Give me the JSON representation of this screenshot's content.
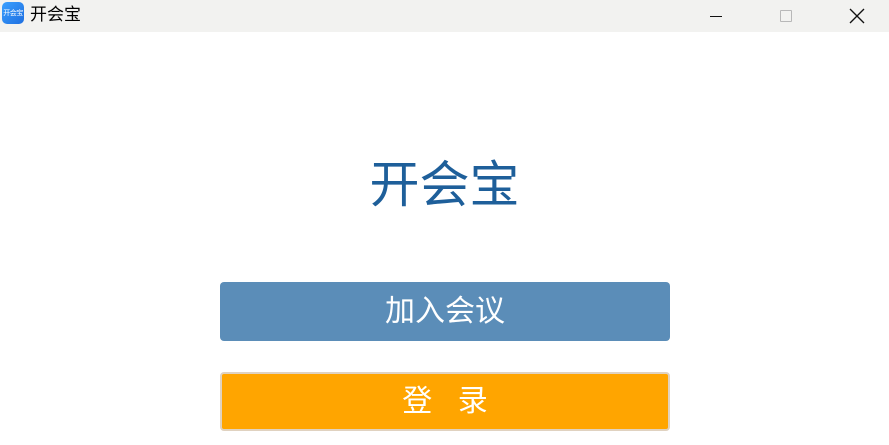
{
  "window": {
    "title": "开会宝",
    "icon_text": "开会宝",
    "icon_name": "app-logo-icon",
    "controls": {
      "minimize_icon": "minimize-icon",
      "maximize_icon": "maximize-icon",
      "close_icon": "close-icon"
    }
  },
  "main": {
    "heading": "开会宝",
    "join_button_label": "加入会议",
    "login_button_label": "登 录"
  },
  "colors": {
    "heading": "#1e5f9a",
    "join_button": "#5b8db8",
    "login_button": "#ffa500",
    "titlebar": "#f2f2f0"
  }
}
